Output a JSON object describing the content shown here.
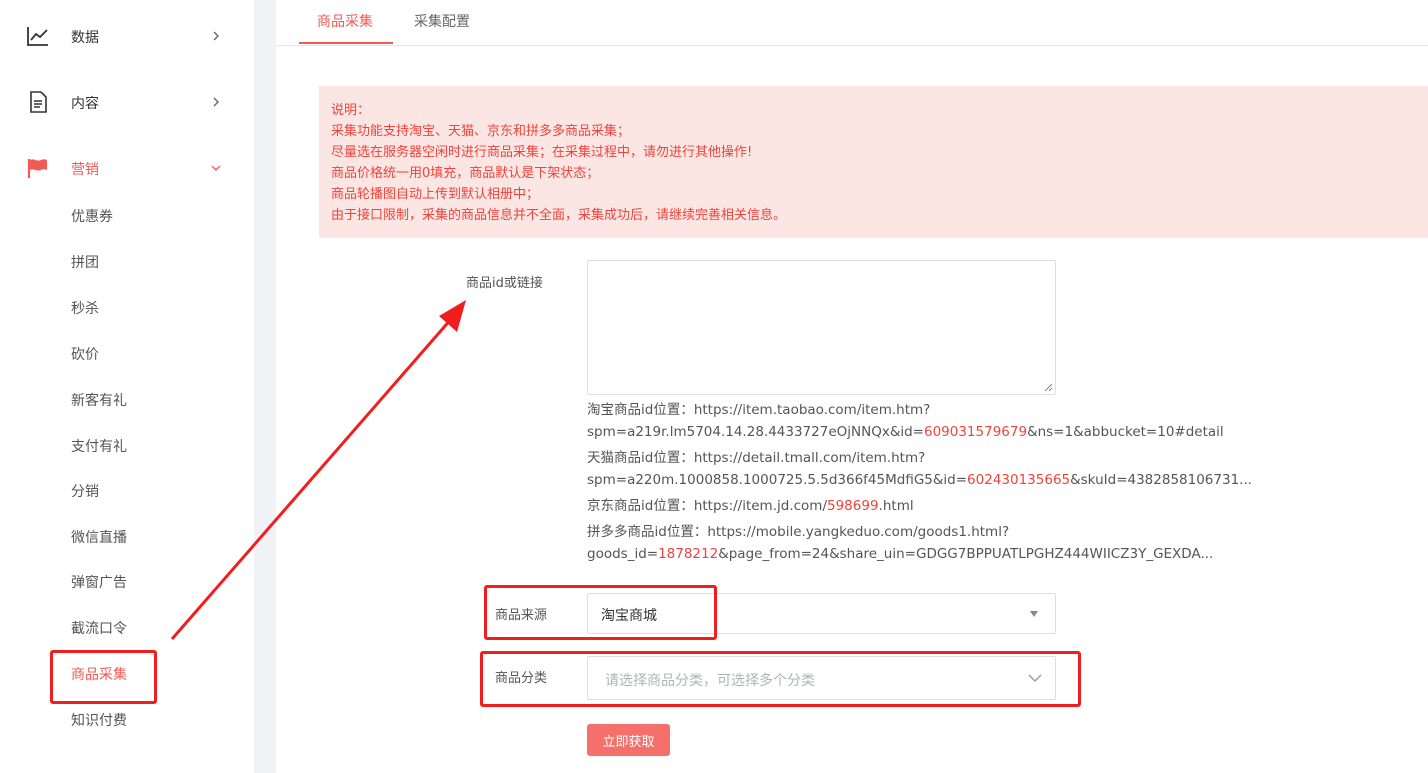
{
  "sidebar": {
    "top_items": [
      {
        "label": "数据",
        "icon": "chart-line-icon"
      },
      {
        "label": "内容",
        "icon": "document-icon"
      },
      {
        "label": "营销",
        "icon": "flag-icon"
      }
    ],
    "sub_items": [
      "优惠券",
      "拼团",
      "秒杀",
      "砍价",
      "新客有礼",
      "支付有礼",
      "分销",
      "微信直播",
      "弹窗广告",
      "截流口令",
      "商品采集",
      "知识付费"
    ],
    "active_sub": "商品采集"
  },
  "tabs": [
    "商品采集",
    "采集配置"
  ],
  "notice": [
    "说明：",
    "采集功能支持淘宝、天猫、京东和拼多多商品采集；",
    "尽量选在服务器空闲时进行商品采集；在采集过程中，请勿进行其他操作!",
    "商品价格统一用0填充，商品默认是下架状态；",
    "商品轮播图自动上传到默认相册中；",
    "由于接口限制，采集的商品信息并不全面，采集成功后，请继续完善相关信息。"
  ],
  "form": {
    "id_label": "商品id或链接",
    "hints": {
      "taobao": {
        "prefix": "淘宝商品id位置：https://item.taobao.com/item.htm?",
        "line2_pre": "spm=a219r.lm5704.14.28.4433727eOjNNQx&id=",
        "id": "609031579679",
        "line2_post": "&ns=1&abbucket=10#detail"
      },
      "tmall": {
        "prefix": "天猫商品id位置：https://detail.tmall.com/item.htm?",
        "line2_pre": "spm=a220m.1000858.1000725.5.5d366f45MdfiG5&id=",
        "id": "602430135665",
        "line2_post": "&skuId=4382858106731..."
      },
      "jd": {
        "pre": "京东商品id位置：https://item.jd.com/",
        "id": "598699",
        "post": ".html"
      },
      "pdd": {
        "prefix": "拼多多商品id位置：https://mobile.yangkeduo.com/goods1.html?",
        "line2_pre": "goods_id=",
        "id": "1878212",
        "line2_post": "&page_from=24&share_uin=GDGG7BPPUATLPGHZ444WIICZ3Y_GEXDA..."
      }
    },
    "source_label": "商品来源",
    "source_value": "淘宝商城",
    "category_label": "商品分类",
    "category_placeholder": "请选择商品分类，可选择多个分类",
    "submit_label": "立即获取"
  },
  "colors": {
    "accent": "#f15b55",
    "annotation": "#f01e1e",
    "notice_bg": "#fbe6e4"
  }
}
